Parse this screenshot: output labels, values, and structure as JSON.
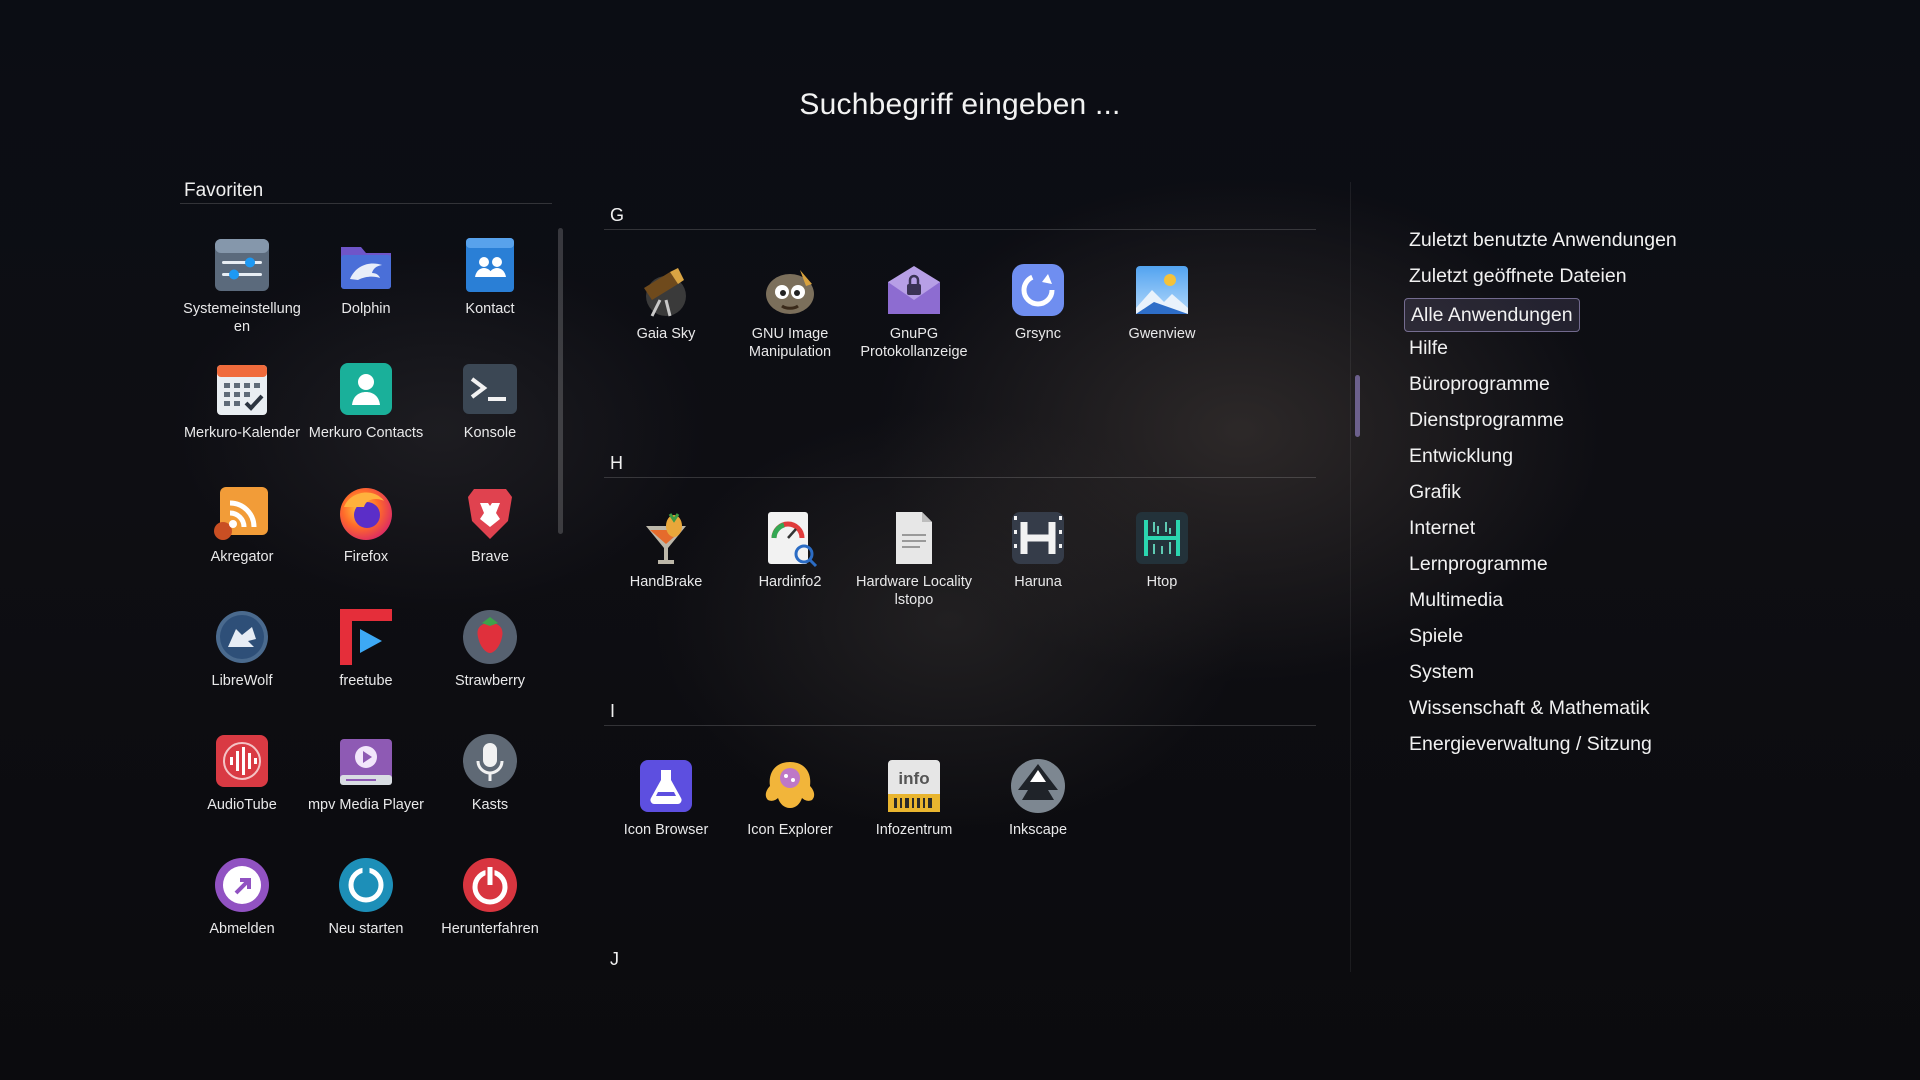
{
  "search": {
    "placeholder": "Suchbegriff eingeben ..."
  },
  "favorites": {
    "title": "Favoriten",
    "items": [
      {
        "label": "Systemeinstellungen",
        "icon": "settings-icon"
      },
      {
        "label": "Dolphin",
        "icon": "dolphin-icon"
      },
      {
        "label": "Kontact",
        "icon": "kontact-icon"
      },
      {
        "label": "Merkuro-Kalender",
        "icon": "calendar-icon"
      },
      {
        "label": "Merkuro Contacts",
        "icon": "contacts-icon"
      },
      {
        "label": "Konsole",
        "icon": "terminal-icon"
      },
      {
        "label": "Akregator",
        "icon": "rss-icon"
      },
      {
        "label": "Firefox",
        "icon": "firefox-icon"
      },
      {
        "label": "Brave",
        "icon": "brave-icon"
      },
      {
        "label": "LibreWolf",
        "icon": "librewolf-icon"
      },
      {
        "label": "freetube",
        "icon": "freetube-icon"
      },
      {
        "label": "Strawberry",
        "icon": "strawberry-icon"
      },
      {
        "label": "AudioTube",
        "icon": "audiotube-icon"
      },
      {
        "label": "mpv Media Player",
        "icon": "mpv-icon"
      },
      {
        "label": "Kasts",
        "icon": "microphone-icon"
      },
      {
        "label": "Abmelden",
        "icon": "logout-icon"
      },
      {
        "label": "Neu starten",
        "icon": "restart-icon"
      },
      {
        "label": "Herunterfahren",
        "icon": "shutdown-icon"
      }
    ]
  },
  "sections": [
    {
      "letter": "G",
      "apps": [
        {
          "label": "Gaia Sky",
          "icon": "telescope-icon"
        },
        {
          "label": "GNU Image Manipulation",
          "icon": "gimp-icon"
        },
        {
          "label": "GnuPG Protokollanzeige",
          "icon": "gnupg-icon"
        },
        {
          "label": "Grsync",
          "icon": "sync-icon"
        },
        {
          "label": "Gwenview",
          "icon": "image-viewer-icon"
        }
      ]
    },
    {
      "letter": "H",
      "apps": [
        {
          "label": "HandBrake",
          "icon": "handbrake-icon"
        },
        {
          "label": "Hardinfo2",
          "icon": "hardinfo-icon"
        },
        {
          "label": "Hardware Locality lstopo",
          "icon": "document-icon"
        },
        {
          "label": "Haruna",
          "icon": "haruna-icon"
        },
        {
          "label": "Htop",
          "icon": "htop-icon"
        }
      ]
    },
    {
      "letter": "I",
      "apps": [
        {
          "label": "Icon Browser",
          "icon": "flask-icon"
        },
        {
          "label": "Icon Explorer",
          "icon": "icon-explorer-icon"
        },
        {
          "label": "Infozentrum",
          "icon": "info-icon"
        },
        {
          "label": "Inkscape",
          "icon": "inkscape-icon"
        }
      ]
    },
    {
      "letter": "J",
      "apps": []
    }
  ],
  "categories": {
    "active": "Alle Anwendungen",
    "items": [
      "Zuletzt benutzte Anwendungen",
      "Zuletzt geöffnete Dateien",
      "Alle Anwendungen",
      "Hilfe",
      "Büroprogramme",
      "Dienstprogramme",
      "Entwicklung",
      "Grafik",
      "Internet",
      "Lernprogramme",
      "Multimedia",
      "Spiele",
      "System",
      "Wissenschaft & Mathematik",
      "Energieverwaltung / Sitzung"
    ]
  },
  "colors": {
    "accent": "#a896e6",
    "text": "#f1f1f1"
  }
}
